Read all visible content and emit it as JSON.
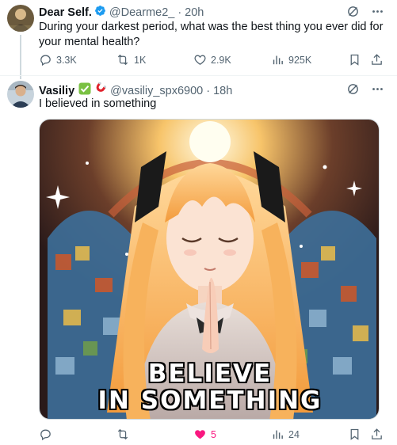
{
  "tweet1": {
    "name": "Dear Self.",
    "handle": "@Dearme2_",
    "separator": "·",
    "time": "20h",
    "text": "During your darkest period, what was the best thing you ever did for your mental health?",
    "stats": {
      "replies": "3.3K",
      "reposts": "1K",
      "likes": "2.9K",
      "views": "925K"
    }
  },
  "tweet2": {
    "name": "Vasiliy",
    "handle": "@vasiliy_spx6900",
    "separator": "·",
    "time": "18h",
    "text": "I believed in something",
    "image_caption_line1": "BELIEVE",
    "image_caption_line2": "IN SOMETHING",
    "stats": {
      "replies": "",
      "reposts": "",
      "likes": "5",
      "views": "24"
    }
  },
  "colors": {
    "verified": "#1d9bf0",
    "like_active": "#f91880",
    "muted": "#536471"
  },
  "icons": [
    "verified-badge-icon",
    "grok-icon",
    "more-icon",
    "reply-icon",
    "repost-icon",
    "like-icon",
    "views-icon",
    "bookmark-icon",
    "share-icon",
    "check-mark-emoji-icon",
    "magnet-emoji-icon"
  ]
}
